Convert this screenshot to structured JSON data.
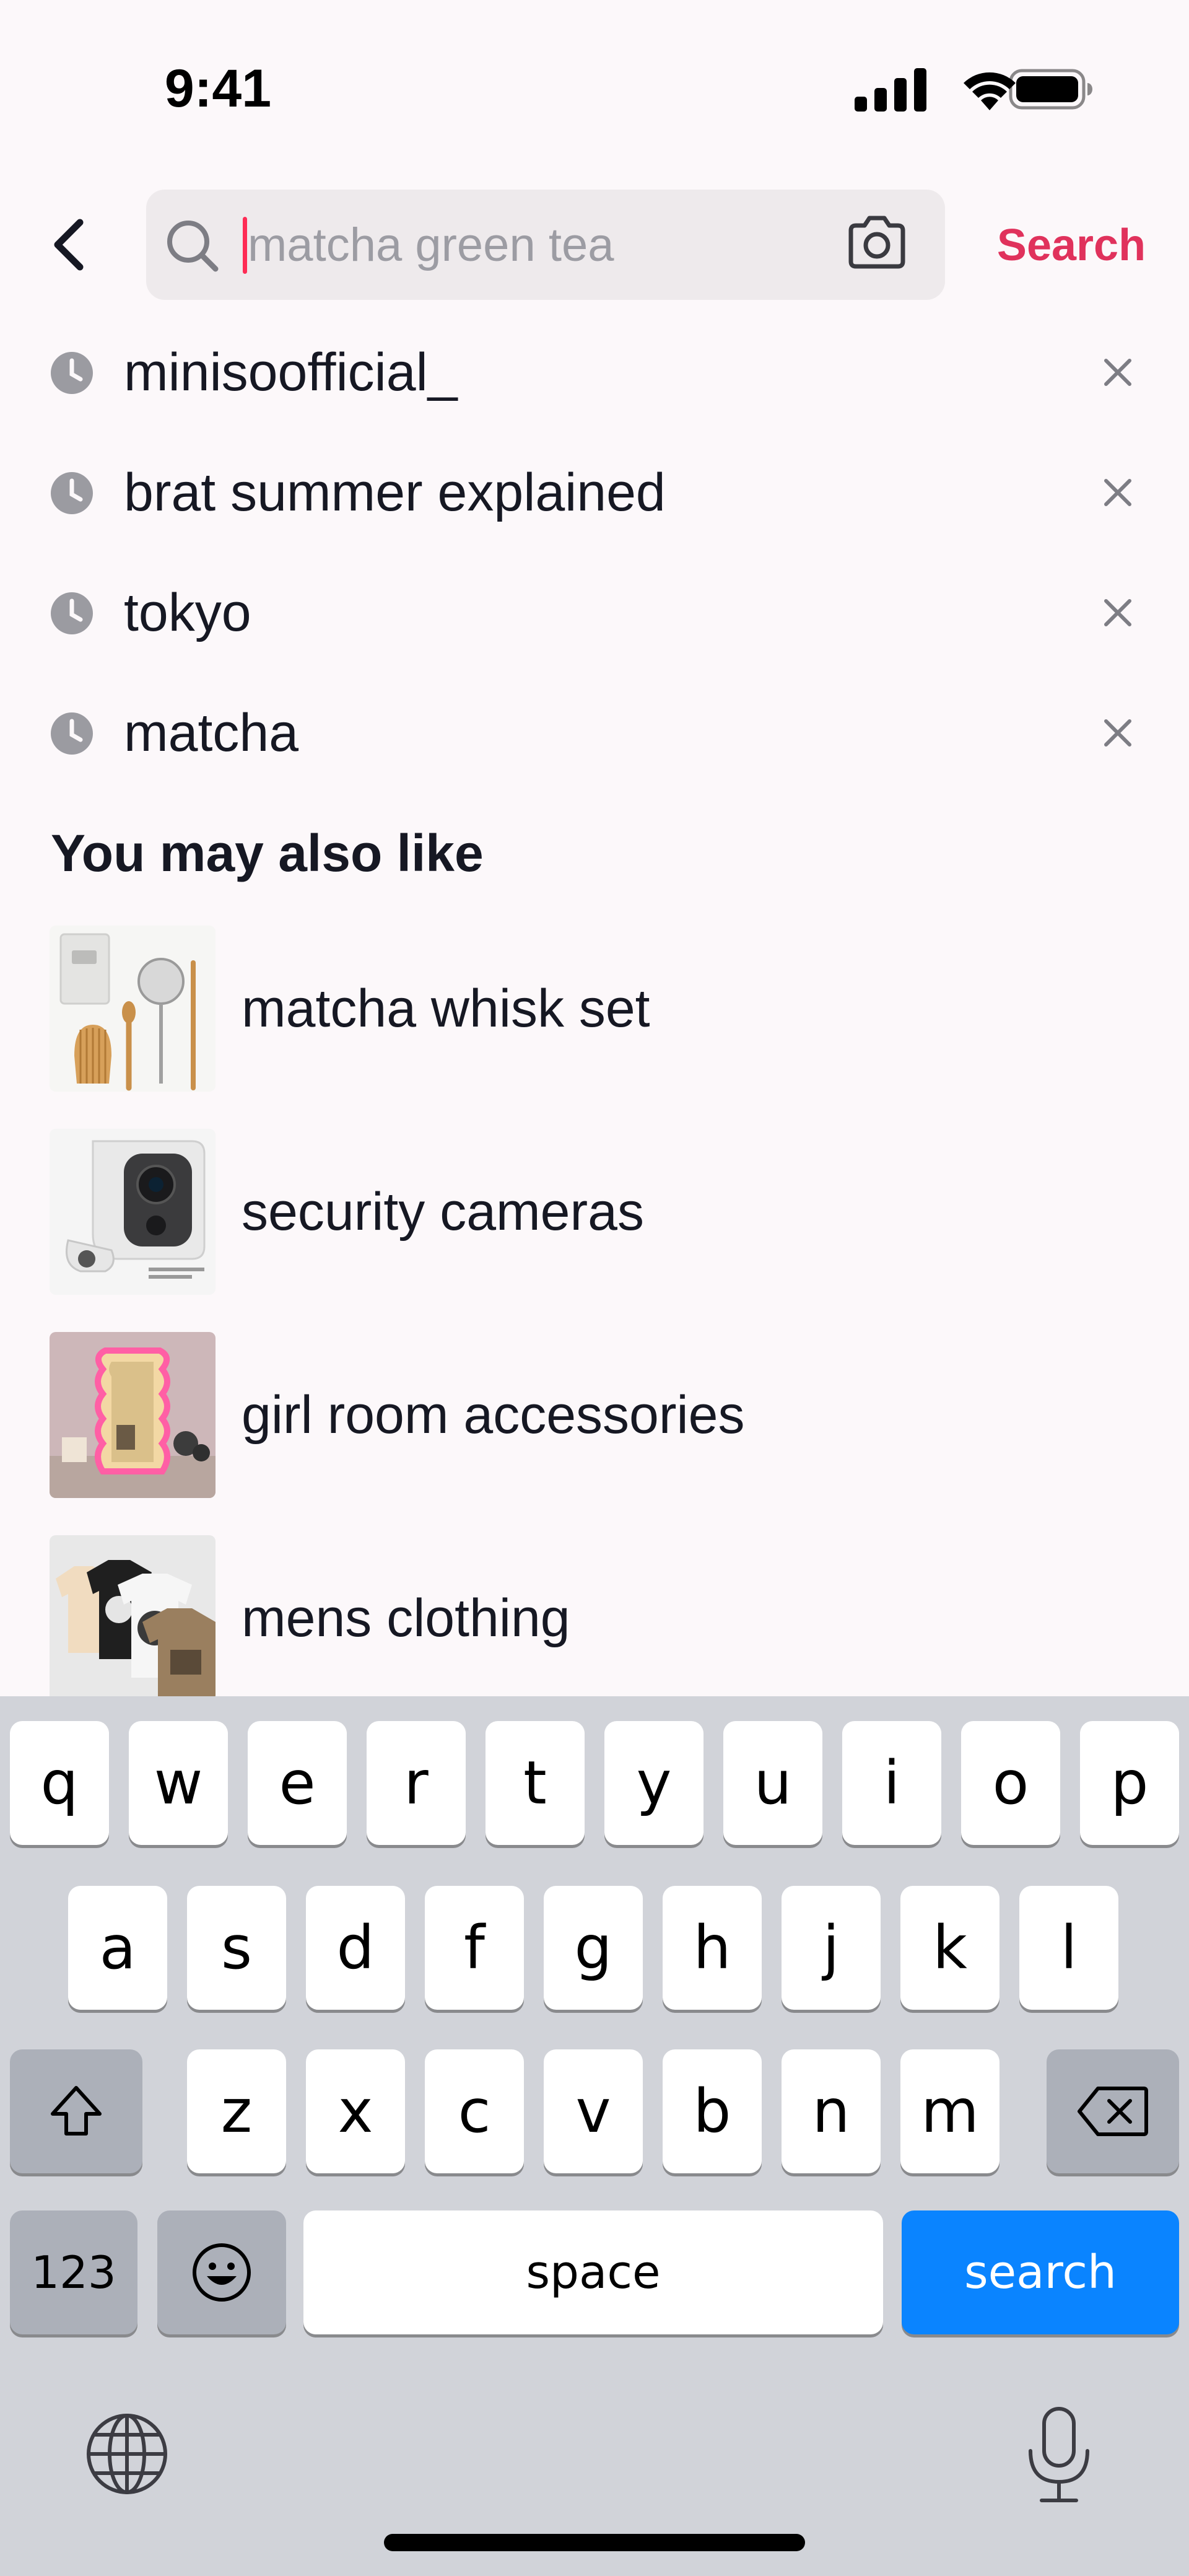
{
  "status_bar": {
    "time": "9:41",
    "icons": [
      "cellular-signal-icon",
      "wifi-icon",
      "battery-icon"
    ]
  },
  "search": {
    "placeholder": "matcha green tea",
    "value": "",
    "submit_label": "Search",
    "accent_color": "#e0325c"
  },
  "history": {
    "items": [
      {
        "label": "minisoofficial_"
      },
      {
        "label": "brat summer explained"
      },
      {
        "label": "tokyo"
      },
      {
        "label": "matcha"
      }
    ]
  },
  "suggestions": {
    "title": "You may also like",
    "items": [
      {
        "label": "matcha whisk set",
        "thumb": "matcha-whisk-set-thumbnail"
      },
      {
        "label": "security cameras",
        "thumb": "security-camera-thumbnail"
      },
      {
        "label": "girl room accessories",
        "thumb": "neon-mirror-thumbnail"
      },
      {
        "label": "mens clothing",
        "thumb": "tshirts-thumbnail"
      }
    ]
  },
  "keyboard": {
    "row1": [
      "q",
      "w",
      "e",
      "r",
      "t",
      "y",
      "u",
      "i",
      "o",
      "p"
    ],
    "row2": [
      "a",
      "s",
      "d",
      "f",
      "g",
      "h",
      "j",
      "k",
      "l"
    ],
    "row3": [
      "z",
      "x",
      "c",
      "v",
      "b",
      "n",
      "m"
    ],
    "numbers_label": "123",
    "space_label": "space",
    "return_label": "search",
    "return_color": "#0a84ff"
  }
}
